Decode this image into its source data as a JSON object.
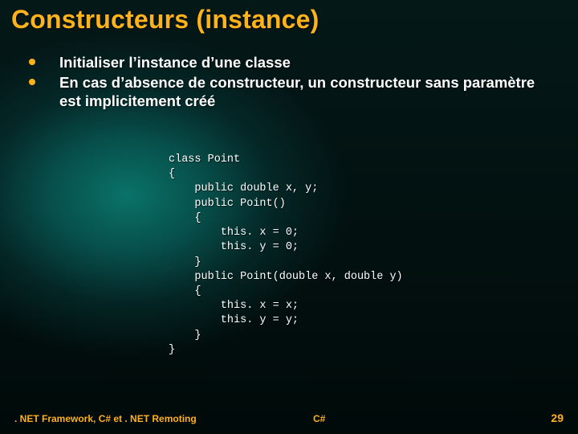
{
  "title": "Constructeurs (instance)",
  "bullets": [
    "Initialiser l’instance d’une classe",
    "En cas d’absence de constructeur, un constructeur sans paramètre est implicitement créé"
  ],
  "code": "class Point\n{\n    public double x, y;\n    public Point()\n    {\n        this. x = 0;\n        this. y = 0;\n    }\n    public Point(double x, double y)\n    {\n        this. x = x;\n        this. y = y;\n    }\n}",
  "footer": {
    "left": ". NET Framework, C# et . NET Remoting",
    "center": "C#",
    "right": "29"
  },
  "colors": {
    "accent": "#ffb31a"
  }
}
